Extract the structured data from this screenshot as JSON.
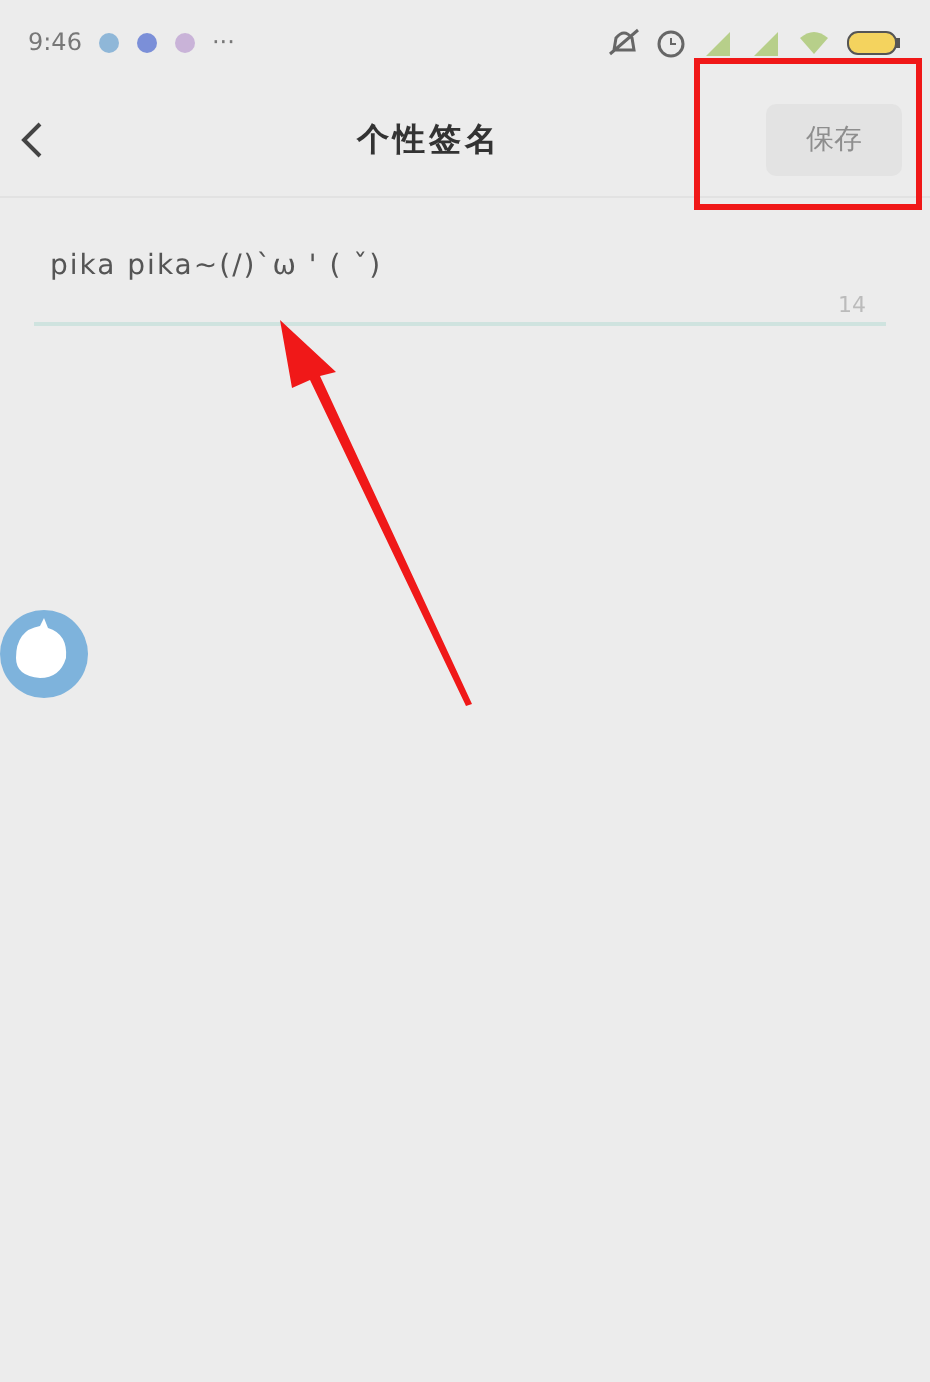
{
  "status_bar": {
    "time": "9:46",
    "more": "···"
  },
  "nav": {
    "title": "个性签名",
    "save_button": {
      "label": "保存",
      "disabled": true
    }
  },
  "signature": {
    "value": "pika pika~(/)`ω ' ( ˇ)",
    "counter": "14"
  }
}
